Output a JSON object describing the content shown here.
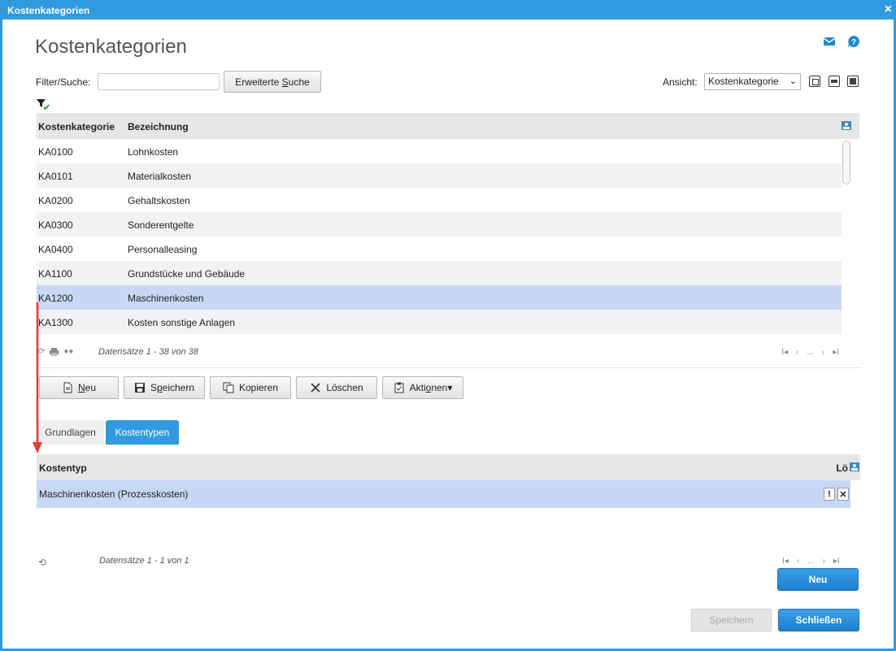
{
  "window": {
    "title": "Kostenkategorien",
    "close_label": "×"
  },
  "page": {
    "title": "Kostenkategorien"
  },
  "filter": {
    "label": "Filter/Suche:",
    "value": "",
    "placeholder": "",
    "advanced_search_pre": "Erweiterte ",
    "advanced_search_mn": "S",
    "advanced_search_post": "uche"
  },
  "view": {
    "label": "Ansicht:",
    "selected": "Kostenkategorie"
  },
  "table1": {
    "headers": [
      "Kostenkategorie",
      "Bezeichnung"
    ],
    "rows": [
      {
        "code": "KA0100",
        "name": "Lohnkosten"
      },
      {
        "code": "KA0101",
        "name": "Materialkosten"
      },
      {
        "code": "KA0200",
        "name": "Gehaltskosten"
      },
      {
        "code": "KA0300",
        "name": "Sonderentgelte"
      },
      {
        "code": "KA0400",
        "name": "Personalleasing"
      },
      {
        "code": "KA1100",
        "name": "Grundstücke und Gebäude"
      },
      {
        "code": "KA1200",
        "name": "Maschinenkosten"
      },
      {
        "code": "KA1300",
        "name": "Kosten sonstige Anlagen"
      }
    ],
    "selected_row": 6,
    "record_info": "Datensätze 1 - 38 von 38",
    "pager_ellipsis": "..."
  },
  "toolbar": {
    "neu_mn": "N",
    "neu_rest": "eu",
    "speichern_pre": "S",
    "speichern_mn": "p",
    "speichern_rest": "eichern",
    "kopieren_label": "Kopieren",
    "loeschen_label": "Löschen",
    "aktionen_pre": "Akti",
    "aktionen_mn": "o",
    "aktionen_rest": "nen"
  },
  "tabs": [
    {
      "label": "Grundlagen",
      "active": false
    },
    {
      "label": "Kostentypen",
      "active": true
    }
  ],
  "table2": {
    "headers": [
      "Kostentyp",
      "Lö"
    ],
    "rows": [
      {
        "name": "Maschinenkosten (Prozesskosten)"
      }
    ],
    "record_info": "Datensätze 1 - 1 von 1",
    "pager_ellipsis": "...",
    "row_action_1": "!",
    "row_action_2": "✕"
  },
  "footer": {
    "neu_label": "Neu",
    "speichern_label": "Speichern",
    "schliessen_label": "Schließen"
  },
  "colors": {
    "accent": "#2f9ae0",
    "selected_row": "#c7d8f6",
    "annotation_arrow": "#e53935"
  }
}
